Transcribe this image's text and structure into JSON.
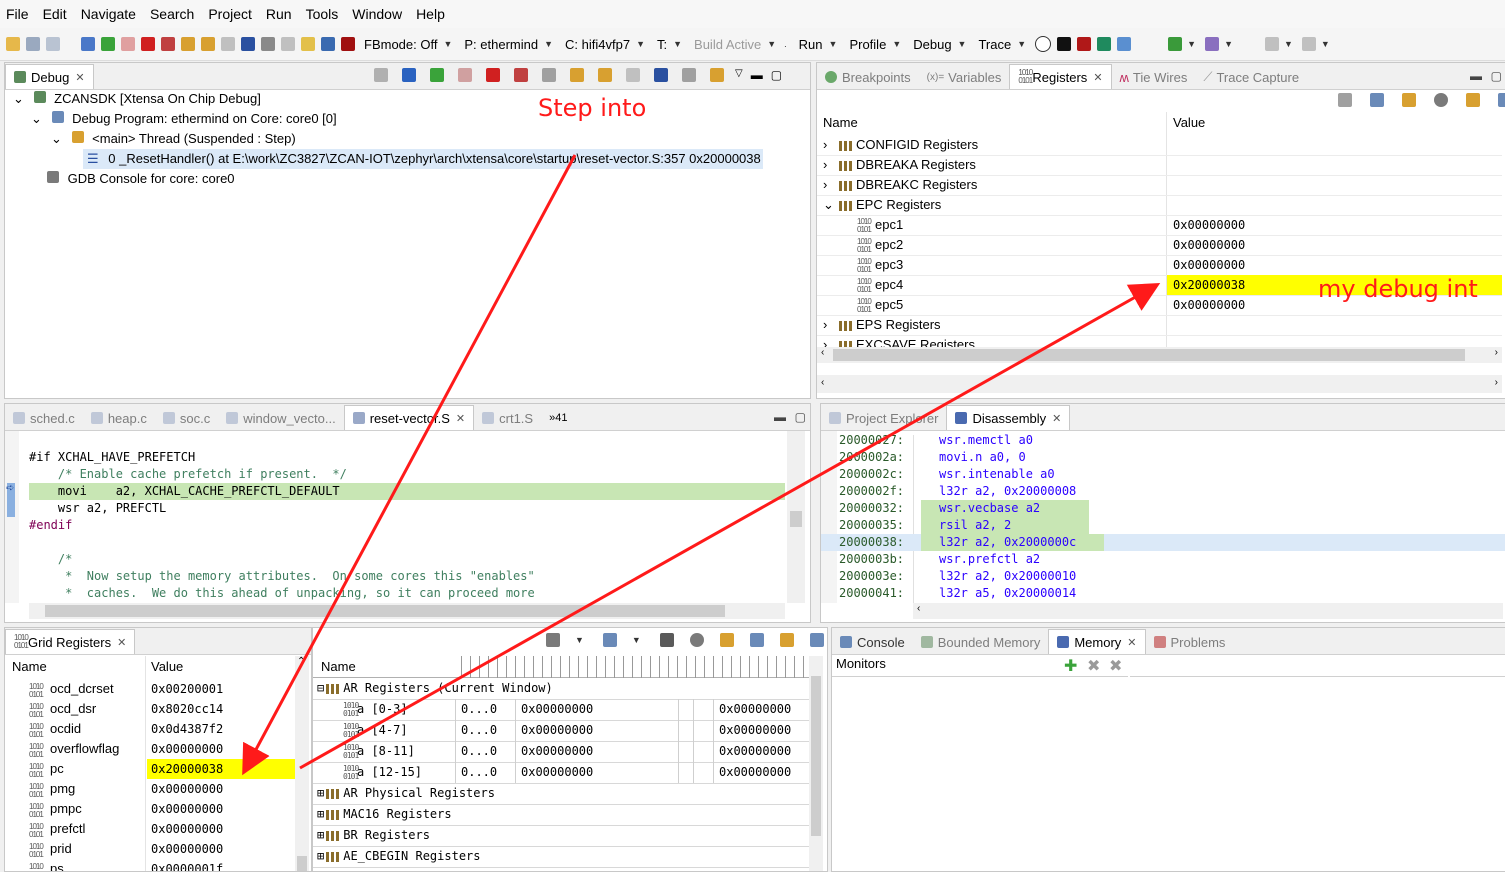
{
  "menu": [
    "File",
    "Edit",
    "Navigate",
    "Search",
    "Project",
    "Run",
    "Tools",
    "Window",
    "Help"
  ],
  "toolbar": {
    "fbmode": "FBmode: Off",
    "project": "P: ethermind",
    "config": "C: hifi4vfp7",
    "target": "T:",
    "build_active": "Build Active",
    "run": "Run",
    "profile": "Profile",
    "debug": "Debug",
    "trace": "Trace"
  },
  "debug_view": {
    "tab": "Debug",
    "items": [
      "ZCANSDK [Xtensa On Chip Debug]",
      "Debug Program: ethermind on Core: core0 [0]",
      "<main> Thread (Suspended : Step)",
      "0 _ResetHandler() at E:\\work\\ZC3827\\ZCAN-IOT\\zephyr\\arch\\xtensa\\core\\startup\\reset-vector.S:357 0x20000038",
      "GDB Console for core: core0"
    ]
  },
  "registers_view": {
    "tabs": [
      "Breakpoints",
      "Variables",
      "Registers",
      "Tie Wires",
      "Trace Capture"
    ],
    "col_name": "Name",
    "col_value": "Value",
    "rows": [
      {
        "name": "CONFIGID Registers",
        "value": "",
        "group": true,
        "expanded": false
      },
      {
        "name": "DBREAKA Registers",
        "value": "",
        "group": true,
        "expanded": false
      },
      {
        "name": "DBREAKC Registers",
        "value": "",
        "group": true,
        "expanded": false
      },
      {
        "name": "EPC Registers",
        "value": "",
        "group": true,
        "expanded": true
      },
      {
        "name": "epc1",
        "value": "0x00000000",
        "group": false
      },
      {
        "name": "epc2",
        "value": "0x00000000",
        "group": false
      },
      {
        "name": "epc3",
        "value": "0x00000000",
        "group": false
      },
      {
        "name": "epc4",
        "value": "0x20000038",
        "group": false,
        "highlight": true
      },
      {
        "name": "epc5",
        "value": "0x00000000",
        "group": false
      },
      {
        "name": "EPS Registers",
        "value": "",
        "group": true,
        "expanded": false
      },
      {
        "name": "EXCSAVE Registers",
        "value": "",
        "group": true,
        "expanded": false
      }
    ]
  },
  "editor": {
    "tabs": [
      "sched.c",
      "heap.c",
      "soc.c",
      "window_vecto...",
      "reset-vector.S",
      "crt1.S",
      "»41"
    ],
    "lines": [
      "#if XCHAL_HAVE_PREFETCH",
      "    /* Enable cache prefetch if present.  */",
      "    movi    a2, XCHAL_CACHE_PREFCTL_DEFAULT",
      "    wsr a2, PREFCTL",
      "#endif",
      "",
      "    /*",
      "     *  Now setup the memory attributes.  On some cores this \"enables\"",
      "     *  caches.  We do this ahead of unpacking, so it can proceed more"
    ]
  },
  "disassembly": {
    "tabs": [
      "Project Explorer",
      "Disassembly"
    ],
    "rows": [
      {
        "addr": "20000027:",
        "instr": "wsr.memctl a0"
      },
      {
        "addr": "2000002a:",
        "instr": "movi.n a0, 0"
      },
      {
        "addr": "2000002c:",
        "instr": "wsr.intenable a0"
      },
      {
        "addr": "2000002f:",
        "instr": "l32r a2, 0x20000008"
      },
      {
        "addr": "20000032:",
        "instr": "wsr.vecbase a2"
      },
      {
        "addr": "20000035:",
        "instr": "rsil a2, 2"
      },
      {
        "addr": "20000038:",
        "instr": "l32r a2, 0x2000000c"
      },
      {
        "addr": "2000003b:",
        "instr": "wsr.prefctl a2"
      },
      {
        "addr": "2000003e:",
        "instr": "l32r a2, 0x20000010"
      },
      {
        "addr": "20000041:",
        "instr": "l32r a5, 0x20000014"
      }
    ]
  },
  "grid_registers": {
    "tab": "Grid Registers",
    "col_name": "Name",
    "col_value": "Value",
    "rows": [
      {
        "name": "ocd_dcrset",
        "value": "0x00200001"
      },
      {
        "name": "ocd_dsr",
        "value": "0x8020cc14"
      },
      {
        "name": "ocdid",
        "value": "0x0d4387f2"
      },
      {
        "name": "overflowflag",
        "value": "0x00000000"
      },
      {
        "name": "pc",
        "value": "0x20000038",
        "highlight": true
      },
      {
        "name": "pmg",
        "value": "0x00000000"
      },
      {
        "name": "pmpc",
        "value": "0x00000000"
      },
      {
        "name": "prefctl",
        "value": "0x00000000"
      },
      {
        "name": "prid",
        "value": "0x00000000"
      },
      {
        "name": "ps",
        "value": "0x0000001f"
      }
    ]
  },
  "ar_registers": {
    "col_name": "Name",
    "rows": [
      {
        "label": "AR Registers (Current Window)",
        "group": true,
        "expanded": true
      },
      {
        "label": "a [0-3]",
        "bits": "0...0",
        "v1": "0x00000000",
        "v2": "0x00000000"
      },
      {
        "label": "a [4-7]",
        "bits": "0...0",
        "v1": "0x00000000",
        "v2": "0x00000000"
      },
      {
        "label": "a [8-11]",
        "bits": "0...0",
        "v1": "0x00000000",
        "v2": "0x00000000"
      },
      {
        "label": "a [12-15]",
        "bits": "0...0",
        "v1": "0x00000000",
        "v2": "0x00000000"
      },
      {
        "label": "AR Physical Registers",
        "group": true
      },
      {
        "label": "MAC16 Registers",
        "group": true
      },
      {
        "label": "BR Registers",
        "group": true
      },
      {
        "label": "AE_CBEGIN Registers",
        "group": true
      }
    ]
  },
  "memory_view": {
    "tabs": [
      "Console",
      "Bounded Memory",
      "Memory",
      "Problems"
    ],
    "monitors": "Monitors"
  },
  "annotations": {
    "step_into": "Step into",
    "my_debug_int": "my debug int"
  },
  "colors": {
    "highlight": "#ffff00",
    "arrow": "#ff1a1a",
    "current_line": "#c8e6b4"
  }
}
